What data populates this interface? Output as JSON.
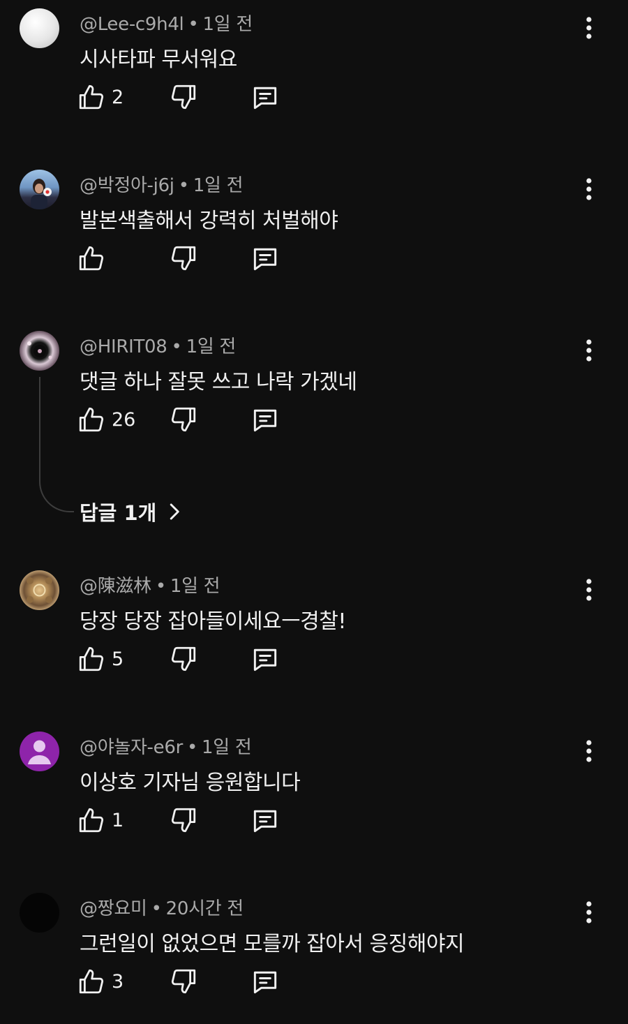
{
  "comments": [
    {
      "author": "@Lee-c9h4l",
      "time": "1일 전",
      "text": "시사타파 무서워요",
      "likes": "2",
      "avatar_color": "#e8e8e8"
    },
    {
      "author": "@박정아-j6j",
      "time": "1일 전",
      "text": "발본색출해서 강력히 처벌해야",
      "likes": "",
      "avatar_color": "#5a7fa8"
    },
    {
      "author": "@HIRIT08",
      "time": "1일 전",
      "text": "댓글 하나 잘못 쓰고 나락 가겠네",
      "likes": "26",
      "avatar_color": "#6a4a5a",
      "replies_label": "답글 1개"
    },
    {
      "author": "@陳滋林",
      "time": "1일 전",
      "text": "당장 당장 잡아들이세요ㅡ경찰!",
      "likes": "5",
      "avatar_color": "#8a6a44"
    },
    {
      "author": "@야놀자-e6r",
      "time": "1일 전",
      "text": "이상호 기자님 응원합니다",
      "likes": "1",
      "avatar_color": "#8e24aa"
    },
    {
      "author": "@짱요미",
      "time": "20시간 전",
      "text": "그런일이 없었으면 모를까 잡아서 응징해야지",
      "likes": "3",
      "avatar_color": "#050505"
    }
  ],
  "icons": {
    "like": "thumb-up-icon",
    "dislike": "thumb-down-icon",
    "reply": "reply-bubble-icon",
    "more": "kebab-menu-icon",
    "chevron": "chevron-right-icon"
  },
  "colors": {
    "background": "#0f0f0f",
    "text": "#f1f1f1",
    "meta": "#aaaaaa"
  }
}
